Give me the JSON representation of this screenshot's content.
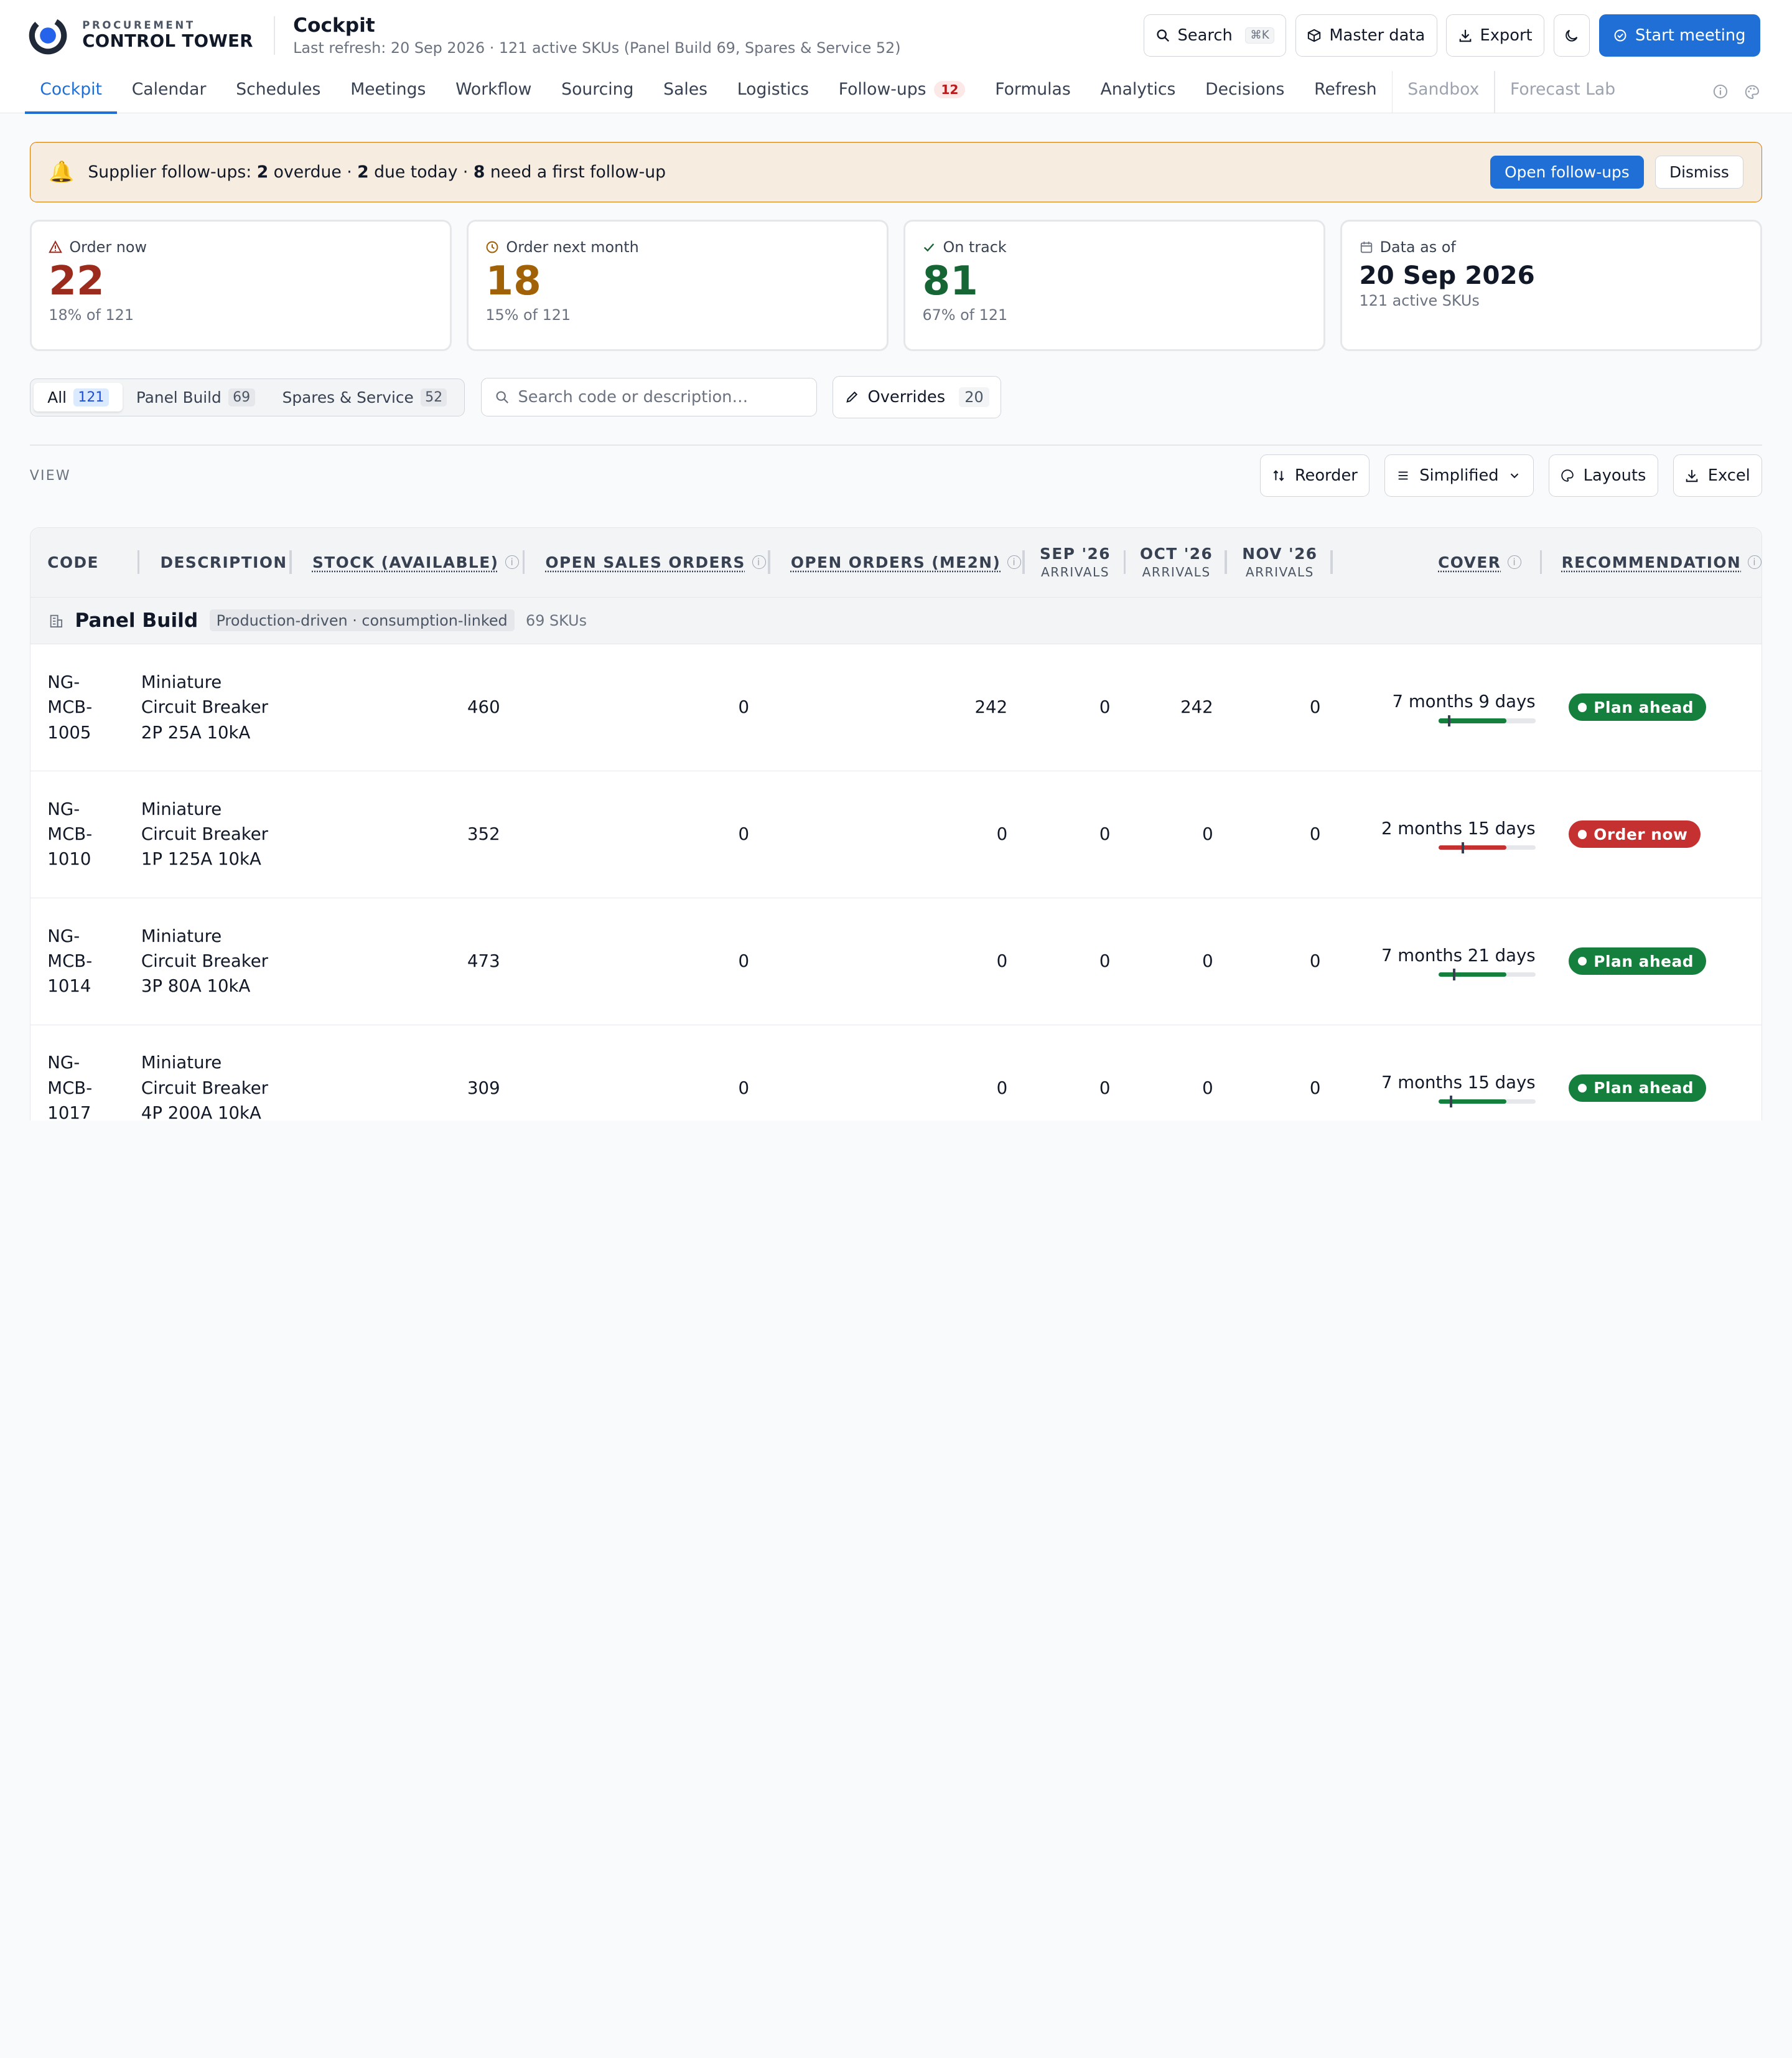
{
  "brand": {
    "small": "PROCUREMENT",
    "big": "CONTROL TOWER"
  },
  "header": {
    "title": "Cockpit",
    "subtitle": "Last refresh: 20 Sep 2026 · 121 active SKUs (Panel Build 69, Spares & Service 52)",
    "search_label": "Search",
    "search_kbd": "⌘K",
    "master_data_label": "Master data",
    "export_label": "Export",
    "start_meeting_label": "Start meeting"
  },
  "nav": {
    "tabs": [
      {
        "label": "Cockpit"
      },
      {
        "label": "Calendar"
      },
      {
        "label": "Schedules"
      },
      {
        "label": "Meetings"
      },
      {
        "label": "Workflow"
      },
      {
        "label": "Sourcing"
      },
      {
        "label": "Sales"
      },
      {
        "label": "Logistics"
      },
      {
        "label": "Follow-ups",
        "count": "12"
      },
      {
        "label": "Formulas"
      },
      {
        "label": "Analytics"
      },
      {
        "label": "Decisions"
      },
      {
        "label": "Refresh"
      },
      {
        "label": "Sandbox"
      },
      {
        "label": "Forecast Lab"
      }
    ]
  },
  "alert": {
    "prefix": "Supplier follow-ups: ",
    "overdue": "2",
    "overdue_text": " overdue · ",
    "due_today": "2",
    "due_today_text": " due today · ",
    "first": "8",
    "first_text": " need a first follow-up",
    "open_label": "Open follow-ups",
    "dismiss_label": "Dismiss"
  },
  "kpis": [
    {
      "label": "Order now",
      "value": "22",
      "sub": "18% of 121",
      "icon": "warning-icon"
    },
    {
      "label": "Order next month",
      "value": "18",
      "sub": "15% of 121",
      "icon": "clock-icon"
    },
    {
      "label": "On track",
      "value": "81",
      "sub": "67% of 121",
      "icon": "check-icon"
    },
    {
      "label": "Data as of",
      "value": "20 Sep 2026",
      "sub": "121 active SKUs",
      "icon": "calendar-icon"
    }
  ],
  "filters": {
    "segments": [
      {
        "label": "All",
        "count": "121"
      },
      {
        "label": "Panel Build",
        "count": "69"
      },
      {
        "label": "Spares & Service",
        "count": "52"
      }
    ],
    "search_placeholder": "Search code or description…",
    "overrides_label": "Overrides",
    "overrides_count": "20"
  },
  "view": {
    "label": "VIEW",
    "reorder_label": "Reorder",
    "mode_label": "Simplified",
    "layouts_label": "Layouts",
    "excel_label": "Excel"
  },
  "table": {
    "headers": {
      "code": "CODE",
      "description": "DESCRIPTION",
      "stock": "STOCK (AVAILABLE)",
      "open_sales": "OPEN SALES ORDERS",
      "open_orders": "OPEN ORDERS (ME2N)",
      "sep": "SEP '26",
      "oct": "OCT '26",
      "nov": "NOV '26",
      "arrivals": "ARRIVALS",
      "cover": "COVER",
      "recommendation": "RECOMMENDATION"
    },
    "group": {
      "title": "Panel Build",
      "tag": "Production-driven · consumption-linked",
      "count": "69 SKUs"
    },
    "rows": [
      {
        "code": "NG-MCB-1005",
        "desc": "Miniature Circuit Breaker 2P 25A 10kA",
        "stock": "460",
        "open_sales": "0",
        "open_orders": "242",
        "sep": "0",
        "oct": "242",
        "nov": "0",
        "cover": "7 months 9 days",
        "rec": "Plan ahead",
        "status": "plan",
        "cover_fill": 0.7,
        "cover_tick": 0.1
      },
      {
        "code": "NG-MCB-1010",
        "desc": "Miniature Circuit Breaker 1P 125A 10kA",
        "stock": "352",
        "open_sales": "0",
        "open_orders": "0",
        "sep": "0",
        "oct": "0",
        "nov": "0",
        "cover": "2 months 15 days",
        "rec": "Order now",
        "status": "order",
        "cover_fill": 0.7,
        "cover_tick": 0.24
      },
      {
        "code": "NG-MCB-1014",
        "desc": "Miniature Circuit Breaker 3P 80A 10kA",
        "stock": "473",
        "open_sales": "0",
        "open_orders": "0",
        "sep": "0",
        "oct": "0",
        "nov": "0",
        "cover": "7 months 21 days",
        "rec": "Plan ahead",
        "status": "plan",
        "cover_fill": 0.7,
        "cover_tick": 0.15
      },
      {
        "code": "NG-MCB-1017",
        "desc": "Miniature Circuit Breaker 4P 200A 10kA",
        "stock": "309",
        "open_sales": "0",
        "open_orders": "0",
        "sep": "0",
        "oct": "0",
        "nov": "0",
        "cover": "7 months 15 days",
        "rec": "Plan ahead",
        "status": "plan",
        "cover_fill": 0.7,
        "cover_tick": 0.12
      }
    ]
  },
  "colors": {
    "accent": "#1f6fd6",
    "order_now": "#9b2c1d",
    "next_month": "#a16207",
    "on_track": "#166534"
  }
}
